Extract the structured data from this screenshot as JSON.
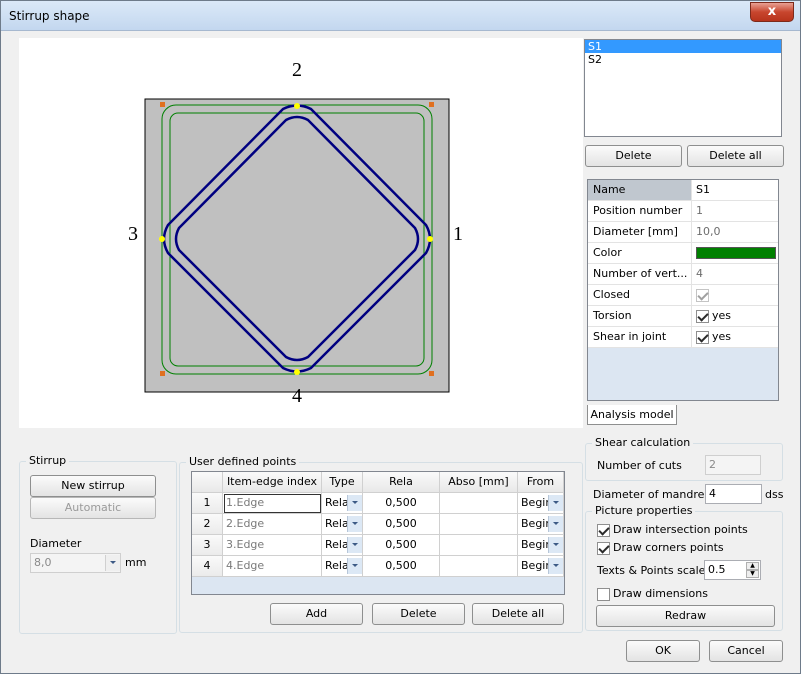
{
  "window": {
    "title": "Stirrup shape",
    "close_glyph": "x"
  },
  "drawing": {
    "edge_labels": {
      "top": "2",
      "right": "1",
      "bottom": "4",
      "left": "3"
    },
    "colors": {
      "section_fill": "#c0c0c0",
      "outer_stirrup": "#008000",
      "inner_stirrup": "#000080",
      "points": "#ffff00",
      "corner_marks": "#e07020"
    }
  },
  "stirrup_list": {
    "items": [
      "S1",
      "S2"
    ],
    "selected_index": 0
  },
  "list_buttons": {
    "delete": "Delete",
    "delete_all": "Delete all"
  },
  "properties": {
    "rows": [
      {
        "name": "Name",
        "value": "S1"
      },
      {
        "name": "Position number",
        "value": "1"
      },
      {
        "name": "Diameter [mm]",
        "value": "10,0"
      },
      {
        "name": "Color",
        "value": "",
        "color": "#008000"
      },
      {
        "name": "Number of vert...",
        "value": "4"
      },
      {
        "name": "Closed",
        "value": ""
      },
      {
        "name": "Torsion",
        "value": "yes"
      },
      {
        "name": "Shear in joint",
        "value": "yes"
      }
    ],
    "tab": "Analysis model"
  },
  "stirrup_group": {
    "title": "Stirrup",
    "new_stirrup": "New stirrup",
    "automatic": "Automatic",
    "diameter_label": "Diameter",
    "diameter_value": "8,0",
    "unit": "mm"
  },
  "user_points": {
    "title": "User defined points",
    "columns": [
      "Item-edge index",
      "Type",
      "Rela",
      "Abso [mm]",
      "From"
    ],
    "rows": [
      {
        "num": "1",
        "edge": "1.Edge",
        "type": "Rela",
        "rela": "0,500",
        "abso": "",
        "from": "Begin"
      },
      {
        "num": "2",
        "edge": "2.Edge",
        "type": "Rela",
        "rela": "0,500",
        "abso": "",
        "from": "Begin"
      },
      {
        "num": "3",
        "edge": "3.Edge",
        "type": "Rela",
        "rela": "0,500",
        "abso": "",
        "from": "Begin"
      },
      {
        "num": "4",
        "edge": "4.Edge",
        "type": "Rela",
        "rela": "0,500",
        "abso": "",
        "from": "Begin"
      }
    ],
    "add": "Add",
    "delete": "Delete",
    "delete_all": "Delete all"
  },
  "shear": {
    "title": "Shear calculation",
    "cuts_label": "Number of cuts",
    "cuts_value": "2"
  },
  "mandrel": {
    "label": "Diameter of mandre",
    "value": "4",
    "unit": "dss"
  },
  "picture": {
    "title": "Picture properties",
    "draw_intersection": "Draw intersection points",
    "draw_corners": "Draw corners points",
    "scale_label": "Texts & Points scale",
    "scale_value": "0.5",
    "draw_dimensions": "Draw dimensions",
    "redraw": "Redraw"
  },
  "dialog": {
    "ok": "OK",
    "cancel": "Cancel"
  }
}
